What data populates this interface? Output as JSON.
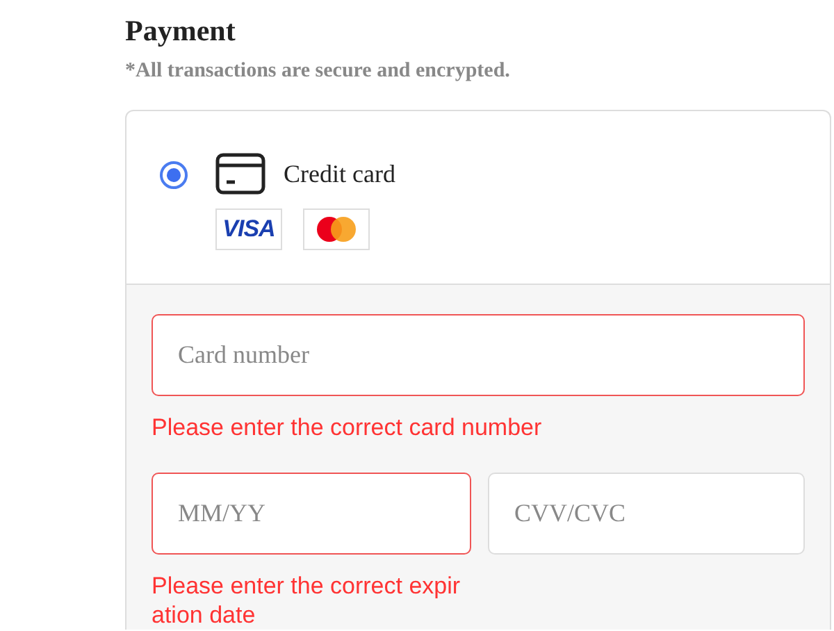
{
  "title": "Payment",
  "subtitle": "*All transactions are secure and encrypted.",
  "methods": [
    {
      "label": "Credit card",
      "selected": true,
      "logos": [
        {
          "kind": "visa",
          "text": "VISA"
        },
        {
          "kind": "mastercard"
        }
      ]
    }
  ],
  "fields": [
    {
      "placeholder": "Card number",
      "invalid": true,
      "error": "Please enter the correct card number"
    },
    {
      "placeholder": "MM/YY",
      "invalid": true,
      "error": "Please enter the correct expiration date"
    },
    {
      "placeholder": "CVV/CVC",
      "invalid": false
    }
  ]
}
